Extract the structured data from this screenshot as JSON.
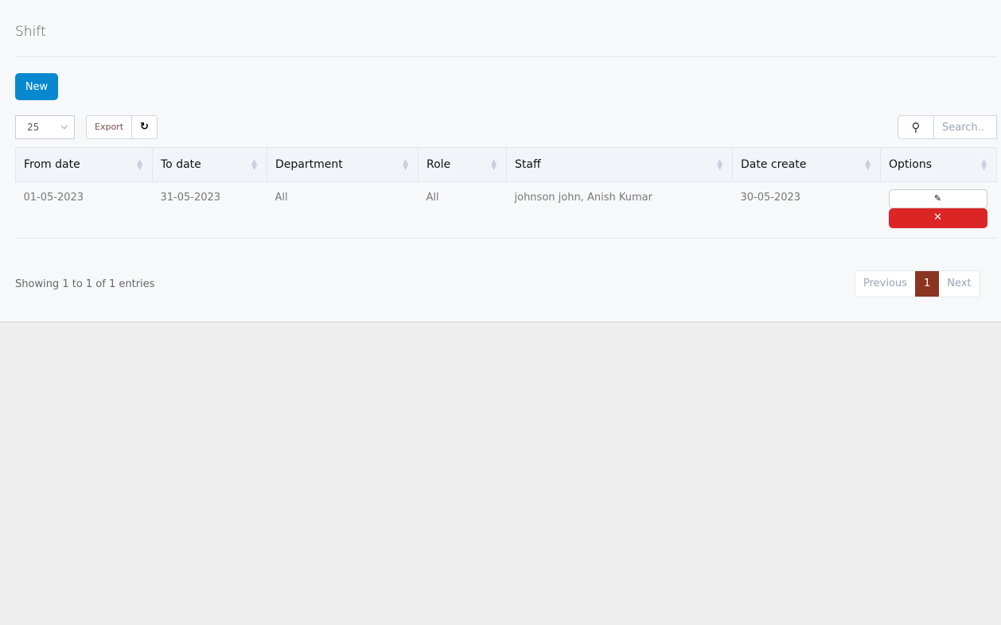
{
  "page": {
    "title": "Shift"
  },
  "toolbar": {
    "new_label": "New",
    "page_size": "25",
    "export_label": "Export",
    "search_placeholder": "Search.."
  },
  "table": {
    "columns": [
      "From date",
      "To date",
      "Department",
      "Role",
      "Staff",
      "Date create",
      "Options"
    ],
    "rows": [
      {
        "from": "01-05-2023",
        "to": "31-05-2023",
        "department": "All",
        "role": "All",
        "staff": "johnson john, Anish Kumar",
        "created": "30-05-2023"
      }
    ]
  },
  "footer": {
    "info": "Showing 1 to 1 of 1 entries",
    "prev": "Previous",
    "page": "1",
    "next": "Next"
  },
  "colors": {
    "primary": "#0788cf",
    "danger": "#dc2626",
    "active_page": "#8b3520"
  }
}
